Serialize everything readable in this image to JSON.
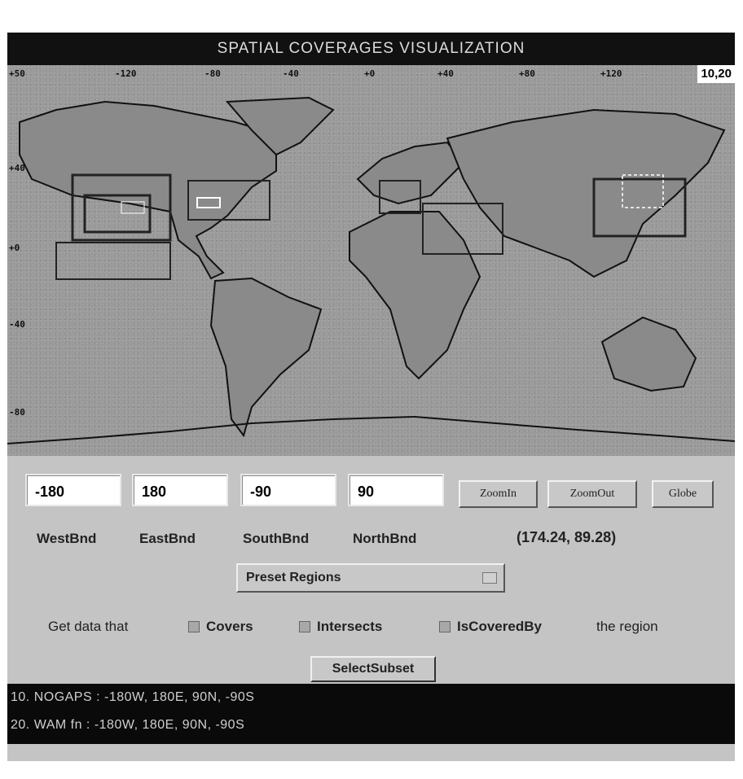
{
  "title": "SPATIAL COVERAGES VISUALIZATION",
  "map": {
    "top_ticks": [
      "+50",
      "-120",
      "-80",
      "-40",
      "+0",
      "+40",
      "+80",
      "+120"
    ],
    "left_ticks": [
      "+40",
      "+0",
      "-40",
      "-80"
    ],
    "cursor_readout": "10,20"
  },
  "bounds": {
    "west": "-180",
    "east": "180",
    "south": "-90",
    "north": "90",
    "west_label": "WestBnd",
    "east_label": "EastBnd",
    "south_label": "SouthBnd",
    "north_label": "NorthBnd"
  },
  "buttons": {
    "zoom_in": "ZoomIn",
    "zoom_out": "ZoomOut",
    "globe": "Globe"
  },
  "coordinates_display": "(174.24, 89.28)",
  "preset_regions": "Preset Regions",
  "filter": {
    "prefix": "Get data that",
    "covers": "Covers",
    "intersects": "Intersects",
    "is_covered_by": "IsCoveredBy",
    "suffix": "the region"
  },
  "select_subset": "SelectSubset",
  "results": [
    "10. NOGAPS : -180W, 180E, 90N, -90S",
    "20. WAM fn : -180W, 180E, 90N, -90S"
  ]
}
